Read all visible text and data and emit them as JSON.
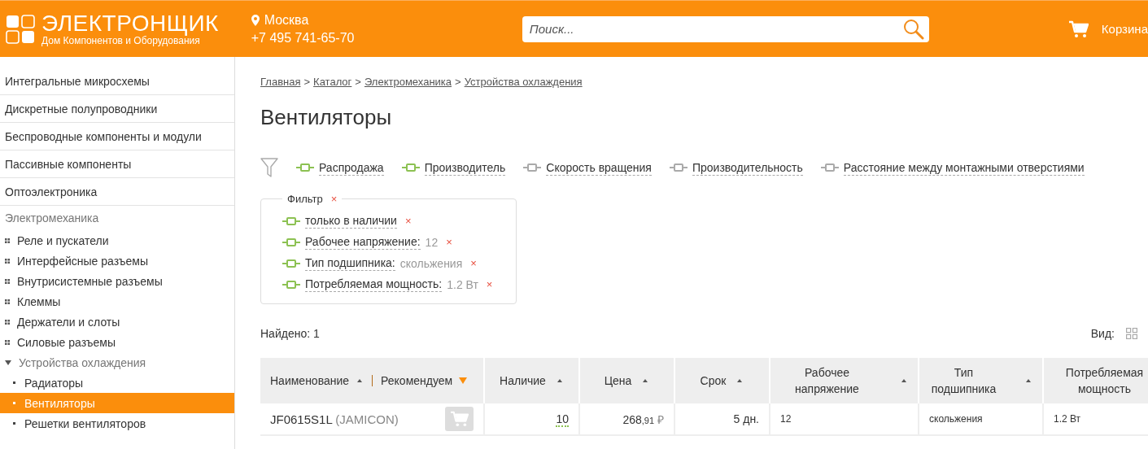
{
  "header": {
    "logo_title": "ЭЛЕКТРОНЩИК",
    "logo_subtitle": "Дом Компонентов и Оборудования",
    "city": "Москва",
    "phone": "+7 495 741-65-70",
    "search": {
      "placeholder": "Поиск..."
    },
    "cart_label": "Корзина"
  },
  "sidebar": {
    "categories": [
      {
        "label": "Интегральные микросхемы",
        "expanded": false
      },
      {
        "label": "Дискретные полупроводники",
        "expanded": false
      },
      {
        "label": "Беспроводные компоненты и модули",
        "expanded": false
      },
      {
        "label": "Пассивные компоненты",
        "expanded": false
      },
      {
        "label": "Оптоэлектроника",
        "expanded": false
      },
      {
        "label": "Электромеханика",
        "expanded": true,
        "children": [
          {
            "label": "Реле и пускатели",
            "expanded": false
          },
          {
            "label": "Интерфейсные разъемы",
            "expanded": false
          },
          {
            "label": "Внутрисистемные разъемы",
            "expanded": false
          },
          {
            "label": "Клеммы",
            "expanded": false
          },
          {
            "label": "Держатели и слоты",
            "expanded": false
          },
          {
            "label": "Силовые разъемы",
            "expanded": false
          },
          {
            "label": "Устройства охлаждения",
            "expanded": true,
            "children": [
              {
                "label": "Радиаторы",
                "selected": false
              },
              {
                "label": "Вентиляторы",
                "selected": true
              },
              {
                "label": "Решетки вентиляторов",
                "selected": false
              }
            ]
          }
        ]
      }
    ]
  },
  "breadcrumbs": [
    "Главная",
    "Каталог",
    "Электромеханика",
    "Устройства охлаждения"
  ],
  "breadcrumb_separator": ">",
  "title": "Вентиляторы",
  "filter_options": [
    {
      "label": "Распродажа",
      "active": true
    },
    {
      "label": "Производитель",
      "active": true
    },
    {
      "label": "Скорость вращения",
      "active": false
    },
    {
      "label": "Производительность",
      "active": false
    },
    {
      "label": "Расстояние между монтажными отверстиями",
      "active": false
    }
  ],
  "filter_box": {
    "title": "Фильтр",
    "remove": "×",
    "items": [
      {
        "label": "только в наличии",
        "value": "",
        "remove": "×"
      },
      {
        "label": "Рабочее напряжение:",
        "value": "12",
        "remove": "×"
      },
      {
        "label": "Тип подшипника:",
        "value": "скольжения",
        "remove": "×"
      },
      {
        "label": "Потребляемая мощность:",
        "value": "1.2 Вт",
        "remove": "×"
      }
    ]
  },
  "found": "Найдено: 1",
  "view_label": "Вид:",
  "table": {
    "name_columns": [
      {
        "label": "Наименование",
        "sorted": false
      },
      {
        "label": "Рекомендуем",
        "sorted": true
      }
    ],
    "columns": [
      {
        "label": "Наличие",
        "sorted": false
      },
      {
        "label": "Цена",
        "sorted": false
      },
      {
        "label": "Срок",
        "sorted": false
      },
      {
        "label": "Рабочее напряжение",
        "sorted": false
      },
      {
        "label": "Тип подшипника",
        "sorted": false
      },
      {
        "label": "Потребляемая мощность"
      }
    ],
    "rows": [
      {
        "part": "JF0615S1L",
        "maker": "(JAMICON)",
        "stock": "10",
        "price_main": "268",
        "price_fraction": ",91",
        "currency": "₽",
        "lead_time": "5 дн.",
        "voltage": "12",
        "bearing": "скольжения",
        "power": "1.2 Вт"
      }
    ]
  }
}
